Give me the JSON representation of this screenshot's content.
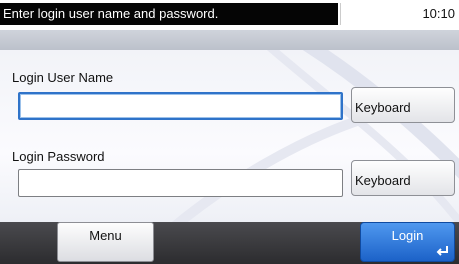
{
  "status": {
    "message": "Enter login user name and password.",
    "time": "10:10"
  },
  "form": {
    "username": {
      "label": "Login User Name",
      "value": "",
      "keyboard_label": "Keyboard"
    },
    "password": {
      "label": "Login Password",
      "value": "",
      "keyboard_label": "Keyboard"
    }
  },
  "footer": {
    "menu_label": "Menu",
    "login_label": "Login",
    "login_icon": "enter-icon"
  },
  "colors": {
    "status_bg": "#050505",
    "accent": "#2f73c9",
    "footer_bg": "#3a3a3d"
  }
}
